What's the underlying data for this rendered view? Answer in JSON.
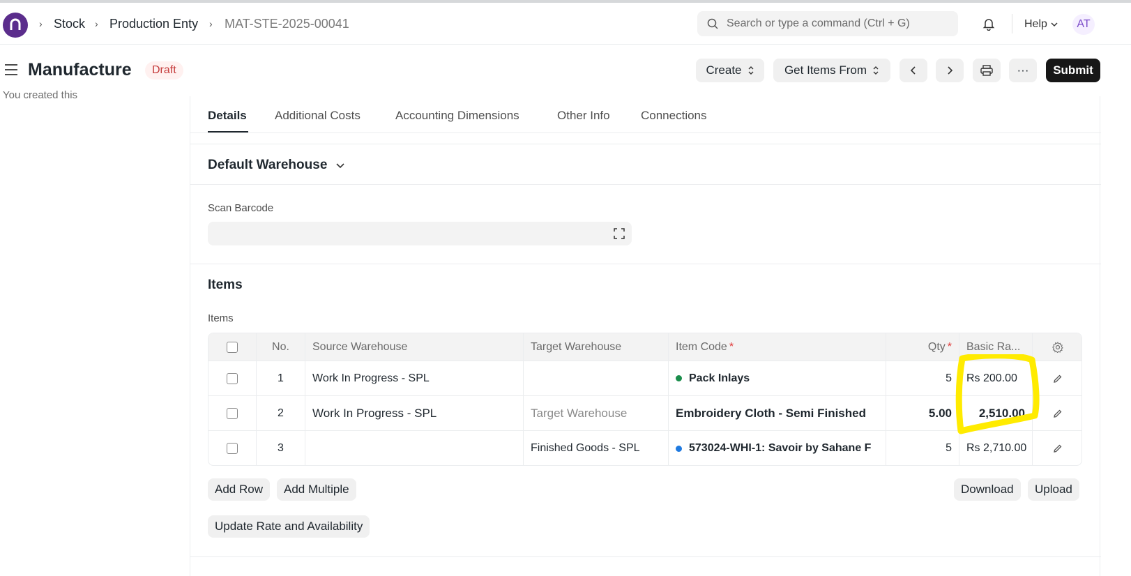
{
  "breadcrumbs": [
    "Stock",
    "Production Enty",
    "MAT-STE-2025-00041"
  ],
  "search": {
    "placeholder": "Search or type a command (Ctrl + G)"
  },
  "nav": {
    "help_label": "Help",
    "avatar_initials": "AT"
  },
  "page": {
    "title": "Manufacture",
    "status": "Draft",
    "buttons": {
      "create": "Create",
      "get_items_from": "Get Items From",
      "submit": "Submit",
      "more": "···"
    },
    "activity_text": "You created this"
  },
  "tabs": [
    "Details",
    "Additional Costs",
    "Accounting Dimensions",
    "Other Info",
    "Connections"
  ],
  "sections": {
    "default_warehouse": "Default Warehouse",
    "scan_barcode_label": "Scan Barcode",
    "items_title": "Items",
    "items_label": "Items"
  },
  "grid": {
    "headers": {
      "no": "No.",
      "source": "Source Warehouse",
      "target": "Target Warehouse",
      "item_code": "Item Code",
      "qty": "Qty",
      "basic_rate": "Basic Ra..."
    },
    "rows": [
      {
        "no": "1",
        "source": "Work In Progress - SPL",
        "target": "",
        "item_code": "Pack Inlays",
        "qty": "5",
        "rate": "Rs 200.00",
        "dot_color": "#1a8d4b"
      },
      {
        "no": "2",
        "source": "Work In Progress - SPL",
        "target": "Target Warehouse",
        "item_code": "Embroidery Cloth - Semi Finished",
        "qty": "5.00",
        "rate": "2,510.00",
        "dot_color": ""
      },
      {
        "no": "3",
        "source": "",
        "target": "Finished Goods - SPL",
        "item_code": "573024-WHI-1: Savoir by Sahane F",
        "qty": "5",
        "rate": "Rs 2,710.00",
        "dot_color": "#1f7ae0"
      }
    ]
  },
  "grid_buttons": {
    "add_row": "Add Row",
    "add_multiple": "Add Multiple",
    "download": "Download",
    "upload": "Upload",
    "update_rate": "Update Rate and Availability"
  },
  "colors": {
    "accent": "#171717",
    "highlight": "#ffeb00",
    "draft_badge": "#c53b3b"
  }
}
